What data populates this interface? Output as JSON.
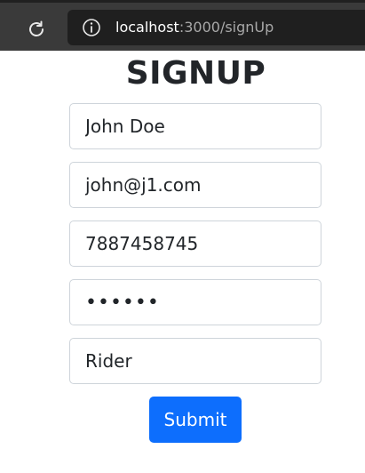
{
  "browser": {
    "url_host": "localhost",
    "url_path": ":3000/signUp"
  },
  "form": {
    "title": "SIGNUP",
    "fields": {
      "name": "John Doe",
      "email": "john@j1.com",
      "phone": "7887458745",
      "password": "••••••",
      "role": "Rider"
    },
    "submit_label": "Submit"
  },
  "colors": {
    "primary": "#0d6efd",
    "browser_toolbar": "#3a3a3a"
  },
  "icons": {
    "reload": "reload-icon",
    "info": "info-icon"
  }
}
